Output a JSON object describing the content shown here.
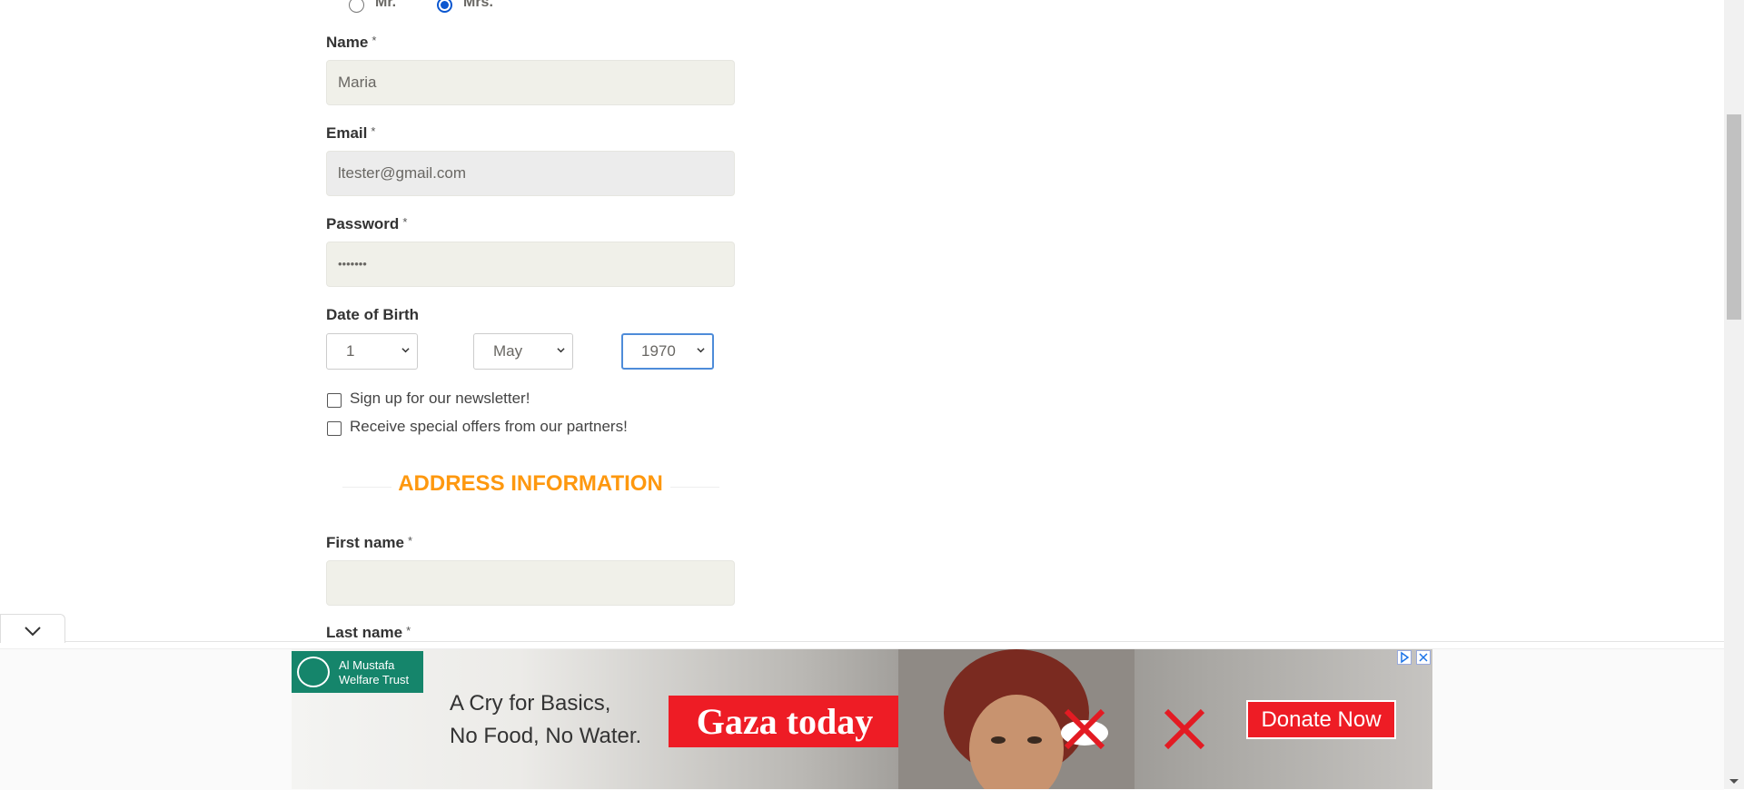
{
  "title_options": {
    "mr_label": "Mr.",
    "mrs_label": "Mrs.",
    "selected": "Mrs."
  },
  "form": {
    "name": {
      "label": "Name",
      "required_mark": "*",
      "value": "Maria"
    },
    "email": {
      "label": "Email",
      "required_mark": "*",
      "value": "ltester@gmail.com"
    },
    "password": {
      "label": "Password",
      "required_mark": "*",
      "value": "•••••••"
    },
    "dob": {
      "label": "Date of Birth",
      "day": "1",
      "month": "May",
      "year": "1970"
    },
    "newsletter": {
      "label": "Sign up for our newsletter!",
      "checked": false
    },
    "offers": {
      "label": "Receive special offers from our partners!",
      "checked": false
    }
  },
  "address": {
    "section_title": "ADDRESS INFORMATION",
    "first_name": {
      "label": "First name",
      "required_mark": "*",
      "value": ""
    },
    "last_name": {
      "label": "Last name",
      "required_mark": "*"
    }
  },
  "ad": {
    "org_line1": "Al Mustafa",
    "org_line2": "Welfare Trust",
    "tagline1": "A Cry for Basics,",
    "tagline2": "No Food, No Water.",
    "headline": "Gaza today",
    "cta": "Donate Now"
  },
  "colors": {
    "accent": "#fe980f",
    "input_bg": "#f0f0e9",
    "radio_checked": "#0b57d0",
    "ad_red": "#ee1c25",
    "ad_green": "#15856b"
  }
}
